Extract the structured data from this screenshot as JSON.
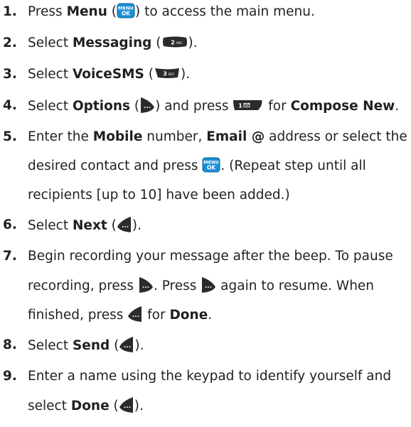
{
  "steps": [
    {
      "n": "1.",
      "lines": [
        [
          {
            "t": "Press "
          },
          {
            "t": "Menu",
            "b": 1
          },
          {
            "t": " ("
          },
          {
            "k": "menu-ok-key-icon"
          },
          {
            "t": ") to access the main menu."
          }
        ]
      ]
    },
    {
      "n": "2.",
      "lines": [
        [
          {
            "t": "Select "
          },
          {
            "t": "Messaging",
            "b": 1
          },
          {
            "t": " ("
          },
          {
            "k": "2abc-key-icon"
          },
          {
            "t": ")."
          }
        ]
      ]
    },
    {
      "n": "3.",
      "lines": [
        [
          {
            "t": "Select "
          },
          {
            "t": "VoiceSMS",
            "b": 1
          },
          {
            "t": " ("
          },
          {
            "k": "3def-key-icon"
          },
          {
            "t": ")."
          }
        ]
      ]
    },
    {
      "n": "4.",
      "lines": [
        [
          {
            "t": "Select "
          },
          {
            "t": "Options",
            "b": 1
          },
          {
            "t": " ("
          },
          {
            "k": "right-softkey-icon"
          },
          {
            "t": ") and press "
          },
          {
            "k": "1-key-icon"
          },
          {
            "t": " for "
          },
          {
            "t": "Compose New",
            "b": 1
          },
          {
            "t": "."
          }
        ]
      ]
    },
    {
      "n": "5.",
      "lines": [
        [
          {
            "t": "Enter the "
          },
          {
            "t": "Mobile",
            "b": 1
          },
          {
            "t": " number, "
          },
          {
            "t": "Email @",
            "b": 1
          },
          {
            "t": " address or select the"
          }
        ],
        [
          {
            "t": "desired contact and press "
          },
          {
            "k": "menu-ok-key-icon"
          },
          {
            "t": ". (Repeat step until all"
          }
        ],
        [
          {
            "t": "recipients [up to 10] have been added.)"
          }
        ]
      ]
    },
    {
      "n": "6.",
      "lines": [
        [
          {
            "t": "Select "
          },
          {
            "t": "Next",
            "b": 1
          },
          {
            "t": " ("
          },
          {
            "k": "left-softkey-icon"
          },
          {
            "t": ")."
          }
        ]
      ]
    },
    {
      "n": "7.",
      "lines": [
        [
          {
            "t": "Begin recording your message after the beep. To pause"
          }
        ],
        [
          {
            "t": "recording, press "
          },
          {
            "k": "right-softkey-icon"
          },
          {
            "t": ". Press "
          },
          {
            "k": "right-softkey-icon"
          },
          {
            "t": " again to resume. When"
          }
        ],
        [
          {
            "t": "finished, press "
          },
          {
            "k": "left-softkey-icon"
          },
          {
            "t": " for "
          },
          {
            "t": "Done",
            "b": 1
          },
          {
            "t": "."
          }
        ]
      ]
    },
    {
      "n": "8.",
      "lines": [
        [
          {
            "t": "Select "
          },
          {
            "t": "Send",
            "b": 1
          },
          {
            "t": " ("
          },
          {
            "k": "left-softkey-icon"
          },
          {
            "t": ")."
          }
        ]
      ]
    },
    {
      "n": "9.",
      "lines": [
        [
          {
            "t": "Enter a name using the keypad to identify yourself and"
          }
        ],
        [
          {
            "t": "select "
          },
          {
            "t": "Done",
            "b": 1
          },
          {
            "t": " ("
          },
          {
            "k": "left-softkey-icon"
          },
          {
            "t": ")."
          }
        ]
      ]
    }
  ],
  "keys": {
    "menu_label": "MENU",
    "ok_label": "OK",
    "two_label": "2",
    "two_letters": "ABC",
    "three_label": "3",
    "three_letters": "DEF",
    "one_label": "1"
  },
  "colors": {
    "text": "#231f20",
    "menu_key": "#1a8fd8",
    "dark_key": "#2b2b2b"
  }
}
